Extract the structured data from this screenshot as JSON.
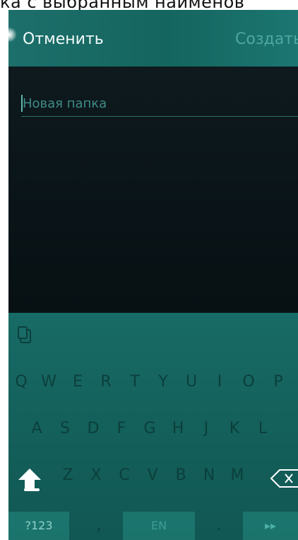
{
  "top_caption": "ка с выбранным наименов",
  "header": {
    "cancel_label": "Отменить",
    "create_label": "Создать"
  },
  "input": {
    "placeholder": "Новая папка"
  },
  "keyboard": {
    "row1": [
      "Q",
      "W",
      "E",
      "R",
      "T",
      "Y",
      "U",
      "I",
      "O",
      "P"
    ],
    "row2": [
      "A",
      "S",
      "D",
      "F",
      "G",
      "H",
      "J",
      "K",
      "L"
    ],
    "row3": [
      "Z",
      "X",
      "C",
      "V",
      "B",
      "N",
      "M"
    ],
    "bottom": {
      "symbols_label": "?123",
      "comma": ",",
      "language_label": "EN",
      "period": ".",
      "enter_icon": "▸▸"
    }
  },
  "colors": {
    "accent": "#1a6e69",
    "field_text": "#3f8c86",
    "content_bg": "#0a1418"
  }
}
